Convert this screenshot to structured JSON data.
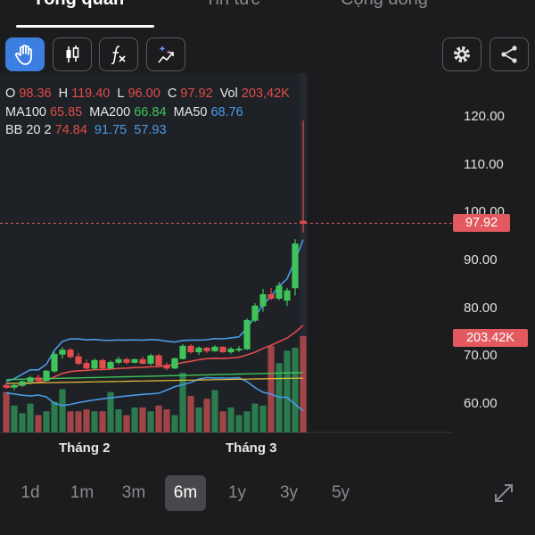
{
  "tabs": [
    {
      "label": "Tổng quan",
      "active": true
    },
    {
      "label": "Tin tức",
      "active": false
    },
    {
      "label": "Cộng đồng",
      "active": false
    }
  ],
  "toolbar": {
    "left_tools": [
      "hand-icon",
      "candlestick-icon",
      "function-icon",
      "magic-wand-icon"
    ],
    "right_tools": [
      "gear-icon",
      "share-icon"
    ]
  },
  "legend": {
    "ohlc": {
      "o_label": "O",
      "o": "98.36",
      "h_label": "H",
      "h": "119.40",
      "l_label": "L",
      "l": "96.00",
      "c_label": "C",
      "c": "97.92",
      "vol_label": "Vol",
      "vol": "203,42K"
    },
    "ma": {
      "ma100_label": "MA100",
      "ma100": "65.85",
      "ma200_label": "MA200",
      "ma200": "66.84",
      "ma50_label": "MA50",
      "ma50": "68.76"
    },
    "bb": {
      "label": "BB 20 2",
      "upper": "74.84",
      "mid": "91.75",
      "lower": "57.93"
    }
  },
  "y_axis": {
    "ticks": [
      "120.00",
      "110.00",
      "100.00",
      "90.00",
      "80.00",
      "70.00",
      "60.00"
    ]
  },
  "price_tag": "97.92",
  "volume_tag": "203.42K",
  "x_axis": {
    "labels": [
      "Tháng 2",
      "Tháng 3"
    ]
  },
  "ranges": [
    {
      "label": "1d",
      "active": false
    },
    {
      "label": "1m",
      "active": false
    },
    {
      "label": "3m",
      "active": false
    },
    {
      "label": "6m",
      "active": true
    },
    {
      "label": "1y",
      "active": false
    },
    {
      "label": "3y",
      "active": false
    },
    {
      "label": "5y",
      "active": false
    }
  ],
  "colors": {
    "up": "#3ec45a",
    "down": "#e24c4c",
    "bb": "#4a9be6",
    "accent": "#3d7fe0"
  },
  "chart_data": {
    "type": "candlestick",
    "ylim": [
      55,
      122
    ],
    "last_candle": {
      "open": 98.36,
      "high": 119.4,
      "low": 96.0,
      "close": 97.92,
      "volume": "203,42K"
    },
    "candles": [
      [
        64,
        64.6,
        63.2,
        63.6
      ],
      [
        63.6,
        64.4,
        63,
        64
      ],
      [
        64,
        65,
        63.6,
        64.8
      ],
      [
        64.8,
        66,
        64.2,
        65.6
      ],
      [
        65.6,
        66.2,
        64.6,
        65
      ],
      [
        65,
        67.2,
        64.8,
        67
      ],
      [
        67,
        71,
        66.6,
        70.5
      ],
      [
        70.5,
        72,
        69.6,
        71.4
      ],
      [
        71.4,
        71.8,
        69.6,
        70
      ],
      [
        70,
        70.8,
        68.2,
        68.6
      ],
      [
        68.6,
        69.4,
        67,
        67.6
      ],
      [
        67.6,
        69.6,
        67.2,
        69.2
      ],
      [
        69.2,
        69.6,
        67.2,
        67.6
      ],
      [
        67.6,
        69.2,
        67.4,
        68.8
      ],
      [
        68.8,
        70,
        68.4,
        69.4
      ],
      [
        69.4,
        69.8,
        68.4,
        68.8
      ],
      [
        68.8,
        69.6,
        68.6,
        69.4
      ],
      [
        69.4,
        70,
        68.4,
        68.6
      ],
      [
        68.6,
        70.6,
        68.2,
        70.2
      ],
      [
        70.2,
        70.6,
        68.2,
        68.2
      ],
      [
        68.2,
        68.8,
        67.2,
        67.6
      ],
      [
        67.6,
        69.8,
        67.4,
        69.6
      ],
      [
        69.6,
        72.6,
        69.4,
        72.2
      ],
      [
        72.2,
        72.6,
        70.6,
        71
      ],
      [
        71,
        72.2,
        70.4,
        71.8
      ],
      [
        71.8,
        72,
        70.8,
        71.2
      ],
      [
        71.2,
        72.4,
        71,
        72
      ],
      [
        72,
        72.2,
        70.8,
        71
      ],
      [
        71,
        72,
        70.6,
        71.6
      ],
      [
        71.6,
        72.2,
        71,
        71.6
      ],
      [
        71.6,
        78,
        71.4,
        77.6
      ],
      [
        77.6,
        81.2,
        77.2,
        80.6
      ],
      [
        80.6,
        84.2,
        79.4,
        83
      ],
      [
        83,
        84.4,
        81.8,
        82.2
      ],
      [
        82.2,
        85.6,
        81.8,
        84.8
      ],
      [
        81.8,
        84.4,
        80.6,
        83.8
      ],
      [
        84.4,
        94.6,
        82.8,
        93.6
      ],
      [
        98.36,
        119.4,
        96.0,
        97.92
      ]
    ],
    "volume_relative": [
      0.42,
      0.28,
      0.2,
      0.3,
      0.18,
      0.22,
      0.32,
      0.45,
      0.22,
      0.22,
      0.24,
      0.22,
      0.22,
      0.42,
      0.24,
      0.18,
      0.26,
      0.26,
      0.22,
      0.28,
      0.24,
      0.18,
      0.62,
      0.38,
      0.26,
      0.35,
      0.44,
      0.22,
      0.26,
      0.18,
      0.22,
      0.3,
      0.28,
      0.9,
      0.72,
      0.85,
      0.88,
      1.0
    ],
    "overlays": [
      "MA100",
      "MA200",
      "MA50",
      "BB 20 2"
    ],
    "x_labels": [
      "Tháng 2",
      "Tháng 3"
    ]
  }
}
